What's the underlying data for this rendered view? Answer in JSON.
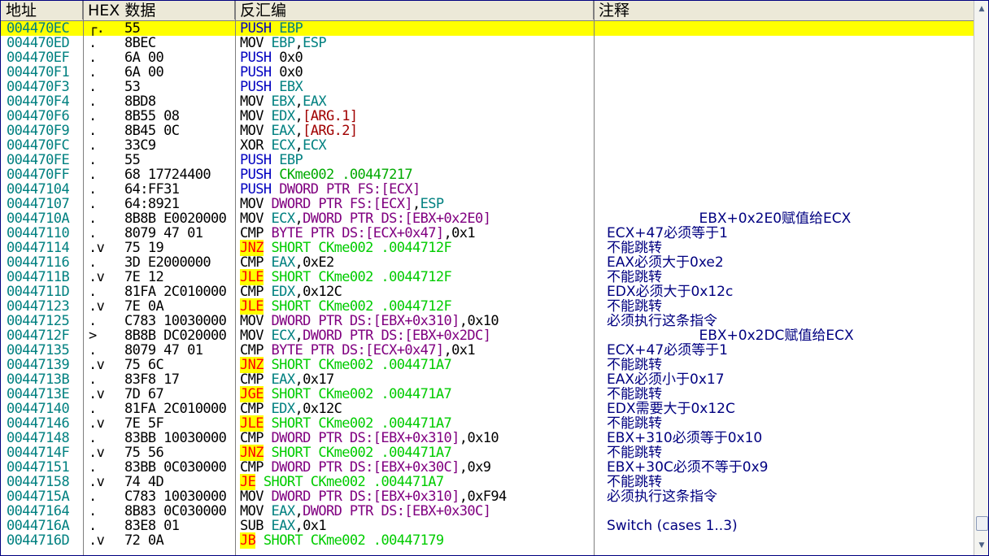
{
  "columns": {
    "addr": "地址",
    "hex": "HEX 数据",
    "disasm": "反汇编",
    "comment": "注释"
  },
  "scrollbar": {
    "up_icon": "▲",
    "down_icon": "▼"
  },
  "rows": [
    {
      "addr": "004470EC",
      "tree": "┌.",
      "hex": "55",
      "disasm": [
        [
          "PUSH",
          "t-push"
        ],
        [
          " ",
          ""
        ],
        [
          "EBP",
          "t-reg"
        ]
      ],
      "comment": "",
      "selected": true
    },
    {
      "addr": "004470ED",
      "tree": ".",
      "hex": "8BEC",
      "disasm": [
        [
          "MOV",
          "t-mov"
        ],
        [
          " ",
          ""
        ],
        [
          "EBP",
          "t-reg"
        ],
        [
          ",",
          ""
        ],
        [
          "ESP",
          "t-reg"
        ]
      ],
      "comment": ""
    },
    {
      "addr": "004470EF",
      "tree": ".",
      "hex": "6A 00",
      "disasm": [
        [
          "PUSH",
          "t-push"
        ],
        [
          " ",
          ""
        ],
        [
          "0x0",
          "t-num"
        ]
      ],
      "comment": ""
    },
    {
      "addr": "004470F1",
      "tree": ".",
      "hex": "6A 00",
      "disasm": [
        [
          "PUSH",
          "t-push"
        ],
        [
          " ",
          ""
        ],
        [
          "0x0",
          "t-num"
        ]
      ],
      "comment": ""
    },
    {
      "addr": "004470F3",
      "tree": ".",
      "hex": "53",
      "disasm": [
        [
          "PUSH",
          "t-push"
        ],
        [
          " ",
          ""
        ],
        [
          "EBX",
          "t-reg"
        ]
      ],
      "comment": ""
    },
    {
      "addr": "004470F4",
      "tree": ".",
      "hex": "8BD8",
      "disasm": [
        [
          "MOV",
          "t-mov"
        ],
        [
          " ",
          ""
        ],
        [
          "EBX",
          "t-reg"
        ],
        [
          ",",
          ""
        ],
        [
          "EAX",
          "t-reg"
        ]
      ],
      "comment": ""
    },
    {
      "addr": "004470F6",
      "tree": ".",
      "hex": "8B55 08",
      "disasm": [
        [
          "MOV",
          "t-mov"
        ],
        [
          " ",
          ""
        ],
        [
          "EDX",
          "t-reg"
        ],
        [
          ",",
          ""
        ],
        [
          "[ARG.1]",
          "t-arg"
        ]
      ],
      "comment": ""
    },
    {
      "addr": "004470F9",
      "tree": ".",
      "hex": "8B45 0C",
      "disasm": [
        [
          "MOV",
          "t-mov"
        ],
        [
          " ",
          ""
        ],
        [
          "EAX",
          "t-reg"
        ],
        [
          ",",
          ""
        ],
        [
          "[ARG.2]",
          "t-arg"
        ]
      ],
      "comment": ""
    },
    {
      "addr": "004470FC",
      "tree": ".",
      "hex": "33C9",
      "disasm": [
        [
          "XOR",
          "t-mov"
        ],
        [
          " ",
          ""
        ],
        [
          "ECX",
          "t-reg"
        ],
        [
          ",",
          ""
        ],
        [
          "ECX",
          "t-reg"
        ]
      ],
      "comment": ""
    },
    {
      "addr": "004470FE",
      "tree": ".",
      "hex": "55",
      "disasm": [
        [
          "PUSH",
          "t-push"
        ],
        [
          " ",
          ""
        ],
        [
          "EBP",
          "t-reg"
        ]
      ],
      "comment": ""
    },
    {
      "addr": "004470FF",
      "tree": ".",
      "hex": "68 17724400",
      "disasm": [
        [
          "PUSH",
          "t-push"
        ],
        [
          " ",
          ""
        ],
        [
          "CKme002 .00447217",
          "t-lbl"
        ]
      ],
      "comment": ""
    },
    {
      "addr": "00447104",
      "tree": ".",
      "hex": "64:FF31",
      "disasm": [
        [
          "PUSH",
          "t-push"
        ],
        [
          " ",
          ""
        ],
        [
          "DWORD PTR FS:[ECX]",
          "t-mem"
        ]
      ],
      "comment": ""
    },
    {
      "addr": "00447107",
      "tree": ".",
      "hex": "64:8921",
      "disasm": [
        [
          "MOV",
          "t-mov"
        ],
        [
          " ",
          ""
        ],
        [
          "DWORD PTR FS:[ECX]",
          "t-mem"
        ],
        [
          ",",
          ""
        ],
        [
          "ESP",
          "t-reg"
        ]
      ],
      "comment": ""
    },
    {
      "addr": "0044710A",
      "tree": ".",
      "hex": "8B8B E0020000",
      "disasm": [
        [
          "MOV",
          "t-mov"
        ],
        [
          " ",
          ""
        ],
        [
          "ECX",
          "t-reg"
        ],
        [
          ",",
          ""
        ],
        [
          "DWORD PTR DS:[EBX+0x2E0]",
          "t-mem"
        ]
      ],
      "comment": "                     EBX+0x2E0赋值给ECX"
    },
    {
      "addr": "00447110",
      "tree": ".",
      "hex": "8079 47 01",
      "disasm": [
        [
          "CMP",
          "t-cmp"
        ],
        [
          " ",
          ""
        ],
        [
          "BYTE PTR DS:[ECX+0x47]",
          "t-mem"
        ],
        [
          ",",
          ""
        ],
        [
          "0x1",
          "t-num"
        ]
      ],
      "comment": "ECX+47必须等于1"
    },
    {
      "addr": "00447114",
      "tree": ".v",
      "hex": "75 19",
      "disasm": [
        [
          "JNZ",
          "t-jmp"
        ],
        [
          " ",
          ""
        ],
        [
          "SHORT CKme002 .0044712F",
          "t-jmpsh"
        ]
      ],
      "comment": "不能跳转"
    },
    {
      "addr": "00447116",
      "tree": ".",
      "hex": "3D E2000000",
      "disasm": [
        [
          "CMP",
          "t-cmp"
        ],
        [
          " ",
          ""
        ],
        [
          "EAX",
          "t-reg"
        ],
        [
          ",",
          ""
        ],
        [
          "0xE2",
          "t-num"
        ]
      ],
      "comment": "EAX必须大于0xe2"
    },
    {
      "addr": "0044711B",
      "tree": ".v",
      "hex": "7E 12",
      "disasm": [
        [
          "JLE",
          "t-jmp"
        ],
        [
          " ",
          ""
        ],
        [
          "SHORT CKme002 .0044712F",
          "t-jmpsh"
        ]
      ],
      "comment": "不能跳转"
    },
    {
      "addr": "0044711D",
      "tree": ".",
      "hex": "81FA 2C010000",
      "disasm": [
        [
          "CMP",
          "t-cmp"
        ],
        [
          " ",
          ""
        ],
        [
          "EDX",
          "t-reg"
        ],
        [
          ",",
          ""
        ],
        [
          "0x12C",
          "t-num"
        ]
      ],
      "comment": "EDX必须大于0x12c"
    },
    {
      "addr": "00447123",
      "tree": ".v",
      "hex": "7E 0A",
      "disasm": [
        [
          "JLE",
          "t-jmp"
        ],
        [
          " ",
          ""
        ],
        [
          "SHORT CKme002 .0044712F",
          "t-jmpsh"
        ]
      ],
      "comment": "不能跳转"
    },
    {
      "addr": "00447125",
      "tree": ".",
      "hex": "C783 10030000",
      "disasm": [
        [
          "MOV",
          "t-mov"
        ],
        [
          " ",
          ""
        ],
        [
          "DWORD PTR DS:[EBX+0x310]",
          "t-mem"
        ],
        [
          ",",
          ""
        ],
        [
          "0x10",
          "t-num"
        ]
      ],
      "comment": "必须执行这条指令"
    },
    {
      "addr": "0044712F",
      "tree": ">",
      "hex": "8B8B DC020000",
      "disasm": [
        [
          "MOV",
          "t-mov"
        ],
        [
          " ",
          ""
        ],
        [
          "ECX",
          "t-reg"
        ],
        [
          ",",
          ""
        ],
        [
          "DWORD PTR DS:[EBX+0x2DC]",
          "t-mem"
        ]
      ],
      "comment": "                     EBX+0x2DC赋值给ECX"
    },
    {
      "addr": "00447135",
      "tree": ".",
      "hex": "8079 47 01",
      "disasm": [
        [
          "CMP",
          "t-cmp"
        ],
        [
          " ",
          ""
        ],
        [
          "BYTE PTR DS:[ECX+0x47]",
          "t-mem"
        ],
        [
          ",",
          ""
        ],
        [
          "0x1",
          "t-num"
        ]
      ],
      "comment": "ECX+47必须等于1"
    },
    {
      "addr": "00447139",
      "tree": ".v",
      "hex": "75 6C",
      "disasm": [
        [
          "JNZ",
          "t-jmp"
        ],
        [
          " ",
          ""
        ],
        [
          "SHORT CKme002 .004471A7",
          "t-jmpsh"
        ]
      ],
      "comment": "不能跳转"
    },
    {
      "addr": "0044713B",
      "tree": ".",
      "hex": "83F8 17",
      "disasm": [
        [
          "CMP",
          "t-cmp"
        ],
        [
          " ",
          ""
        ],
        [
          "EAX",
          "t-reg"
        ],
        [
          ",",
          ""
        ],
        [
          "0x17",
          "t-num"
        ]
      ],
      "comment": "EAX必须小于0x17"
    },
    {
      "addr": "0044713E",
      "tree": ".v",
      "hex": "7D 67",
      "disasm": [
        [
          "JGE",
          "t-jmp"
        ],
        [
          " ",
          ""
        ],
        [
          "SHORT CKme002 .004471A7",
          "t-jmpsh"
        ]
      ],
      "comment": "不能跳转"
    },
    {
      "addr": "00447140",
      "tree": ".",
      "hex": "81FA 2C010000",
      "disasm": [
        [
          "CMP",
          "t-cmp"
        ],
        [
          " ",
          ""
        ],
        [
          "EDX",
          "t-reg"
        ],
        [
          ",",
          ""
        ],
        [
          "0x12C",
          "t-num"
        ]
      ],
      "comment": "EDX需要大于0x12C"
    },
    {
      "addr": "00447146",
      "tree": ".v",
      "hex": "7E 5F",
      "disasm": [
        [
          "JLE",
          "t-jmp"
        ],
        [
          " ",
          ""
        ],
        [
          "SHORT CKme002 .004471A7",
          "t-jmpsh"
        ]
      ],
      "comment": "不能跳转"
    },
    {
      "addr": "00447148",
      "tree": ".",
      "hex": "83BB 10030000",
      "disasm": [
        [
          "CMP",
          "t-cmp"
        ],
        [
          " ",
          ""
        ],
        [
          "DWORD PTR DS:[EBX+0x310]",
          "t-mem"
        ],
        [
          ",",
          ""
        ],
        [
          "0x10",
          "t-num"
        ]
      ],
      "comment": "EBX+310必须等于0x10"
    },
    {
      "addr": "0044714F",
      "tree": ".v",
      "hex": "75 56",
      "disasm": [
        [
          "JNZ",
          "t-jmp"
        ],
        [
          " ",
          ""
        ],
        [
          "SHORT CKme002 .004471A7",
          "t-jmpsh"
        ]
      ],
      "comment": "不能跳转"
    },
    {
      "addr": "00447151",
      "tree": ".",
      "hex": "83BB 0C030000",
      "disasm": [
        [
          "CMP",
          "t-cmp"
        ],
        [
          " ",
          ""
        ],
        [
          "DWORD PTR DS:[EBX+0x30C]",
          "t-mem"
        ],
        [
          ",",
          ""
        ],
        [
          "0x9",
          "t-num"
        ]
      ],
      "comment": "EBX+30C必须不等于0x9"
    },
    {
      "addr": "00447158",
      "tree": ".v",
      "hex": "74 4D",
      "disasm": [
        [
          "JE",
          "t-jmp"
        ],
        [
          " ",
          ""
        ],
        [
          "SHORT CKme002 .004471A7",
          "t-jmpsh"
        ]
      ],
      "comment": "不能跳转"
    },
    {
      "addr": "0044715A",
      "tree": ".",
      "hex": "C783 10030000",
      "disasm": [
        [
          "MOV",
          "t-mov"
        ],
        [
          " ",
          ""
        ],
        [
          "DWORD PTR DS:[EBX+0x310]",
          "t-mem"
        ],
        [
          ",",
          ""
        ],
        [
          "0xF94",
          "t-num"
        ]
      ],
      "comment": "必须执行这条指令"
    },
    {
      "addr": "00447164",
      "tree": ".",
      "hex": "8B83 0C030000",
      "disasm": [
        [
          "MOV",
          "t-mov"
        ],
        [
          " ",
          ""
        ],
        [
          "EAX",
          "t-reg"
        ],
        [
          ",",
          ""
        ],
        [
          "DWORD PTR DS:[EBX+0x30C]",
          "t-mem"
        ]
      ],
      "comment": ""
    },
    {
      "addr": "0044716A",
      "tree": ".",
      "hex": "83E8 01",
      "disasm": [
        [
          "SUB",
          "t-sub"
        ],
        [
          " ",
          ""
        ],
        [
          "EAX",
          "t-reg"
        ],
        [
          ",",
          ""
        ],
        [
          "0x1",
          "t-num"
        ]
      ],
      "comment": "Switch (cases 1..3)"
    },
    {
      "addr": "0044716D",
      "tree": ".v",
      "hex": "72 0A",
      "disasm": [
        [
          "JB",
          "t-jmp"
        ],
        [
          " ",
          ""
        ],
        [
          "SHORT CKme002 .00447179",
          "t-jmpsh"
        ]
      ],
      "comment": ""
    }
  ]
}
